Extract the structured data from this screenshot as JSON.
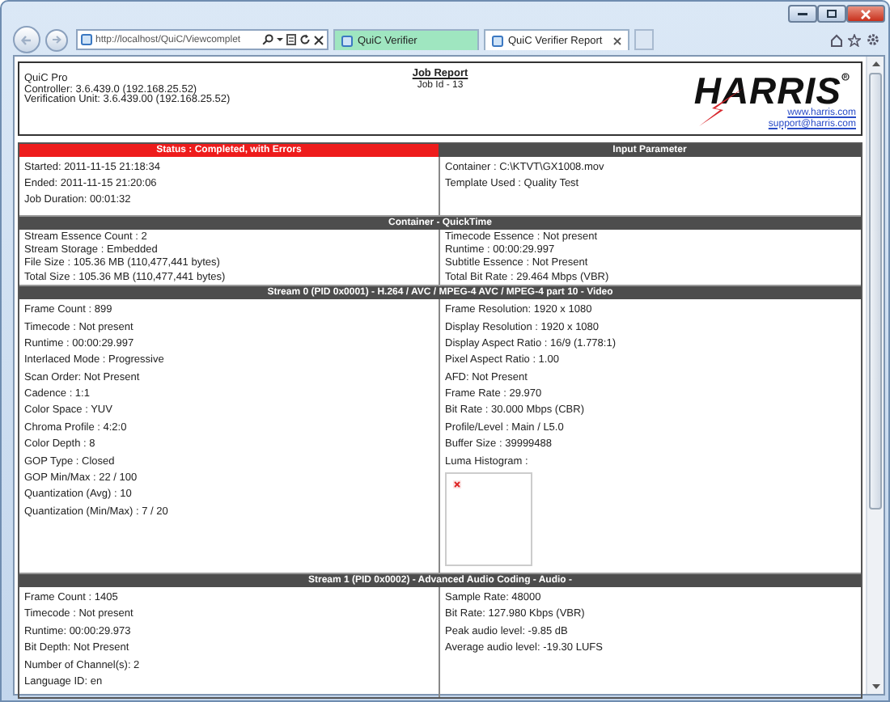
{
  "browser": {
    "address": "http://localhost/QuiC/Viewcomplet",
    "tabs": [
      {
        "label": "QuiC Verifier",
        "selected": false
      },
      {
        "label": "QuiC Verifier Report",
        "selected": true
      }
    ]
  },
  "header": {
    "info": [
      "QuiC Pro",
      "Controller: 3.6.439.0 (192.168.25.52)",
      "Verification Unit: 3.6.439.00 (192.168.25.52)"
    ],
    "title": "Job Report",
    "job_id": "Job Id - 13",
    "logo": "HARRIS",
    "links": [
      "www.harris.com",
      "support@harris.com"
    ]
  },
  "report": {
    "sections": [
      {
        "kind": "status",
        "color": "#ee1c1c",
        "left_title": "Status : Completed, with Errors",
        "right_title": "Input Parameter",
        "left": [
          "Started: 2011-11-15 21:18:34",
          "Ended: 2011-11-15 21:20:06",
          "Job Duration: 00:01:32"
        ],
        "right": [
          "Container : C:\\KTVT\\GX1008.mov",
          "Template Used : Quality Test"
        ]
      },
      {
        "kind": "container",
        "title": "Container - QuickTime",
        "left": [
          "Stream Essence Count : 2",
          "Stream Storage : Embedded",
          "File Size : 105.36 MB (110,477,441 bytes)",
          "Total Size : 105.36 MB (110,477,441 bytes)"
        ],
        "right": [
          "Timecode Essence : Not present",
          "Runtime : 00:00:29.997",
          "Subtitle Essence : Not Present",
          "Total Bit Rate : 29.464 Mbps (VBR)"
        ]
      },
      {
        "kind": "video",
        "title": "Stream 0 (PID 0x0001) - H.264 / AVC / MPEG-4 AVC / MPEG-4 part 10 - Video",
        "left": [
          "Frame Count : 899",
          "Timecode : Not present",
          "Runtime : 00:00:29.997",
          "Interlaced Mode : Progressive",
          "Scan Order: Not Present",
          "Cadence : 1:1",
          "Color Space : YUV",
          "Chroma Profile : 4:2:0",
          "Color Depth : 8",
          "GOP Type : Closed",
          "GOP Min/Max : 22 / 100",
          "Quantization (Avg) : 10",
          "Quantization (Min/Max) : 7 / 20"
        ],
        "right": [
          "Frame Resolution: 1920 x 1080",
          "Display Resolution : 1920 x 1080",
          "Display Aspect Ratio : 16/9 (1.778:1)",
          "Pixel Aspect Ratio : 1.00",
          "AFD: Not Present",
          "Frame Rate : 29.970",
          "Bit Rate : 30.000 Mbps (CBR)",
          "Profile/Level : Main / L5.0",
          "Buffer Size : 39999488",
          "Luma Histogram :"
        ]
      },
      {
        "kind": "audio",
        "title": "Stream 1 (PID 0x0002) - Advanced Audio Coding - Audio -",
        "left": [
          "Frame Count : 1405",
          "Timecode : Not present",
          "Runtime: 00:00:29.973",
          "Bit Depth: Not Present",
          "Number of Channel(s): 2",
          "Language ID: en"
        ],
        "right": [
          "Sample Rate: 48000",
          "Bit Rate: 127.980 Kbps (VBR)",
          "Peak audio level: -9.85 dB",
          "Average audio level: -19.30 LUFS"
        ]
      }
    ]
  }
}
